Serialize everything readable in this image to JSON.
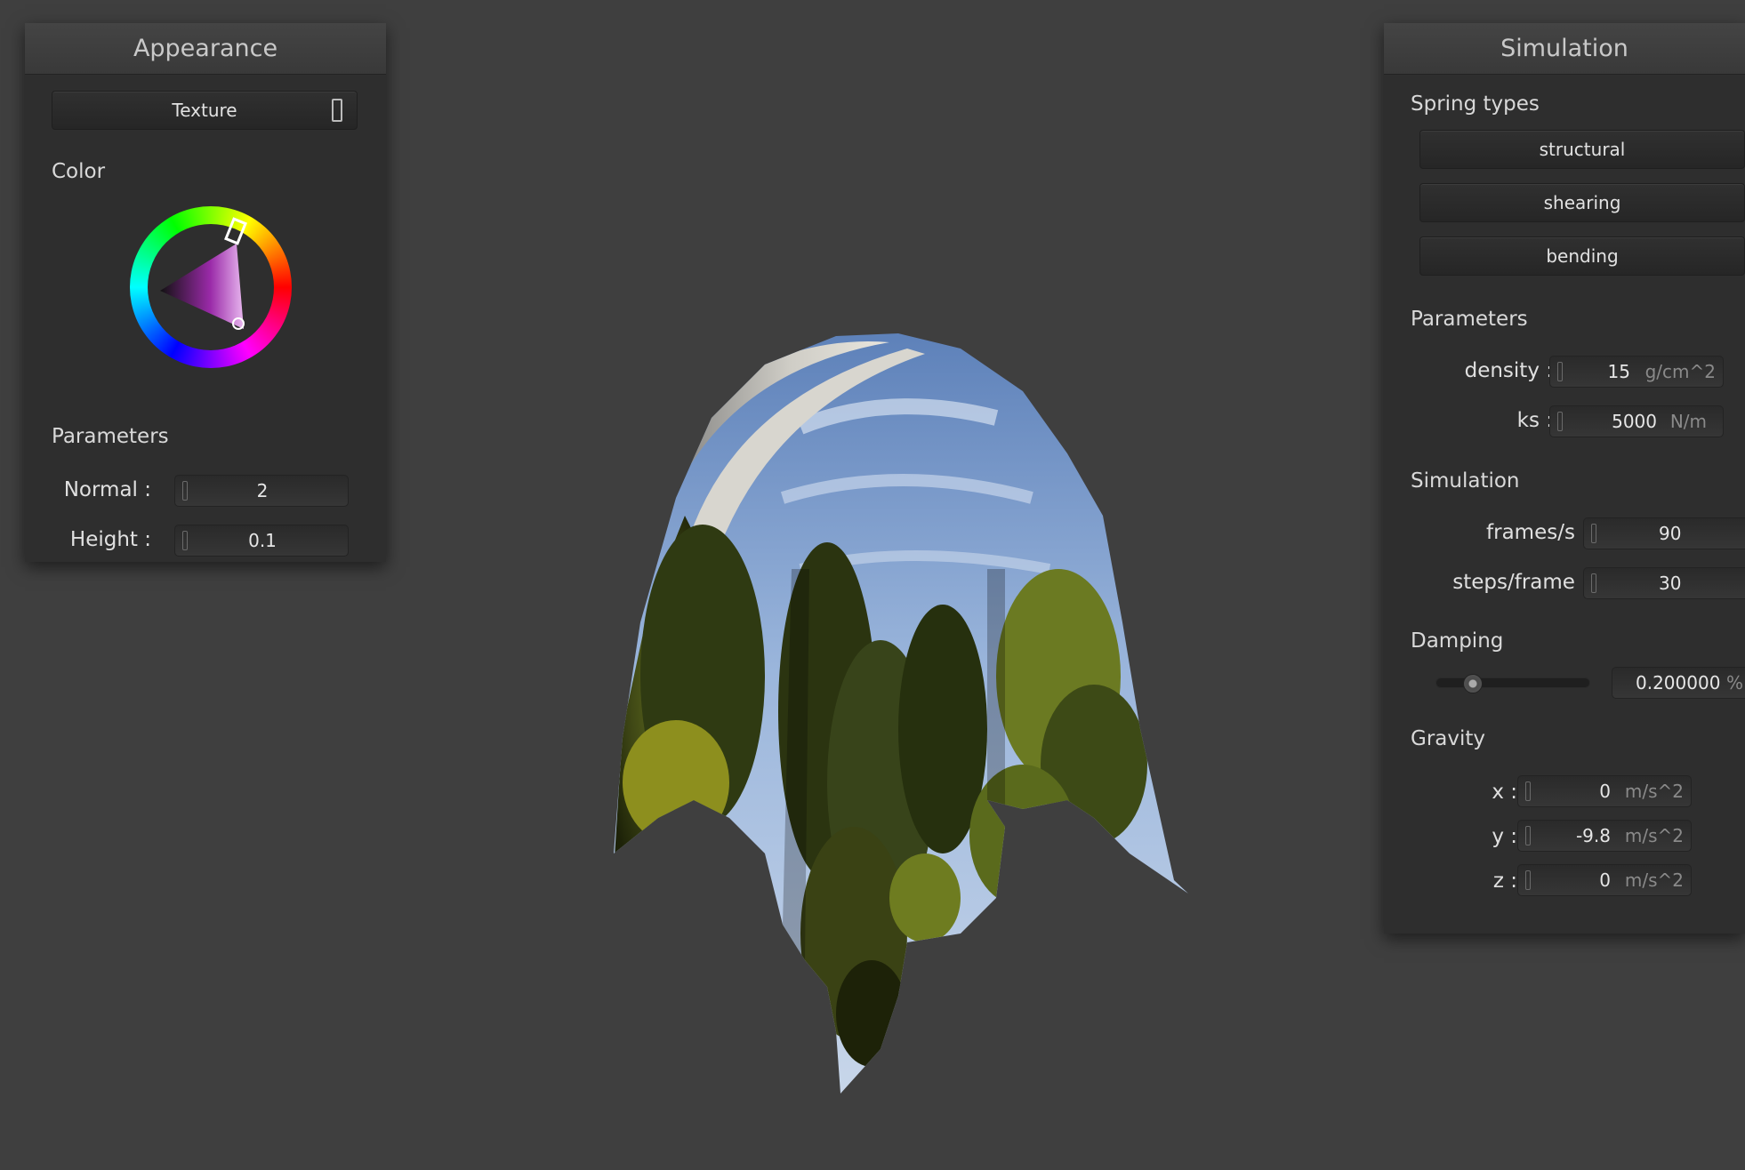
{
  "appearance": {
    "title": "Appearance",
    "texture_button": "Texture",
    "color_label": "Color",
    "parameters_label": "Parameters",
    "normal": {
      "label": "Normal :",
      "value": "2"
    },
    "height": {
      "label": "Height :",
      "value": "0.1"
    },
    "color_value": "#d23be0"
  },
  "simulation": {
    "title": "Simulation",
    "spring_types_label": "Spring types",
    "springs": [
      "structural",
      "shearing",
      "bending"
    ],
    "parameters_label": "Parameters",
    "density": {
      "label": "density :",
      "value": "15",
      "unit": "g/cm^2"
    },
    "ks": {
      "label": "ks :",
      "value": "5000",
      "unit": "N/m"
    },
    "simulation_label": "Simulation",
    "fps": {
      "label": "frames/s :",
      "value": "90"
    },
    "steps": {
      "label": "steps/frame :",
      "value": "30"
    },
    "damping_label": "Damping",
    "damping": {
      "value": "0.200000",
      "unit": "%",
      "slider_fraction": 0.2
    },
    "gravity_label": "Gravity",
    "gx": {
      "label": "x :",
      "value": "0",
      "unit": "m/s^2"
    },
    "gy": {
      "label": "y :",
      "value": "-9.8",
      "unit": "m/s^2"
    },
    "gz": {
      "label": "z :",
      "value": "0",
      "unit": "m/s^2"
    }
  }
}
